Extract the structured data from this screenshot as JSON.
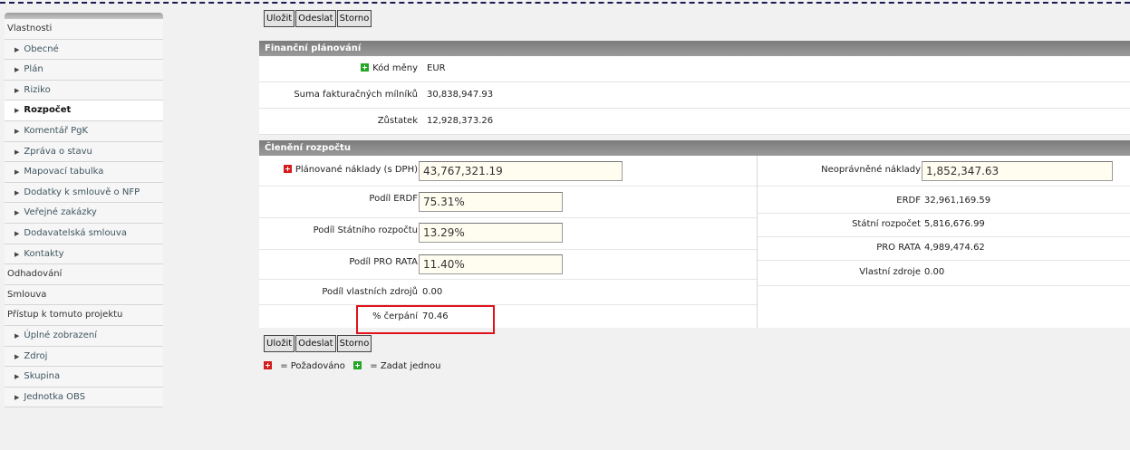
{
  "sidebar": {
    "items": [
      {
        "label": "Vlastnosti",
        "level": "top"
      },
      {
        "label": "Obecné",
        "level": "sub"
      },
      {
        "label": "Plán",
        "level": "sub"
      },
      {
        "label": "Riziko",
        "level": "sub"
      },
      {
        "label": "Rozpočet",
        "level": "sub",
        "active": true
      },
      {
        "label": "Komentář PgK",
        "level": "sub"
      },
      {
        "label": "Zpráva o stavu",
        "level": "sub"
      },
      {
        "label": "Mapovací tabulka",
        "level": "sub"
      },
      {
        "label": "Dodatky k smlouvě o NFP",
        "level": "sub"
      },
      {
        "label": "Veřejné zakázky",
        "level": "sub"
      },
      {
        "label": "Dodavatelská smlouva",
        "level": "sub"
      },
      {
        "label": "Kontakty",
        "level": "sub"
      },
      {
        "label": "Odhadování",
        "level": "top"
      },
      {
        "label": "Smlouva",
        "level": "top"
      },
      {
        "label": "Přístup k tomuto projektu",
        "level": "top"
      },
      {
        "label": "Úplné zobrazení",
        "level": "sub"
      },
      {
        "label": "Zdroj",
        "level": "sub"
      },
      {
        "label": "Skupina",
        "level": "sub"
      },
      {
        "label": "Jednotka OBS",
        "level": "sub"
      }
    ]
  },
  "buttons": {
    "save": "Uložit",
    "send": "Odeslat",
    "cancel": "Storno"
  },
  "financni": {
    "title": "Finanční plánování",
    "kod_label": "Kód měny",
    "kod_value": "EUR",
    "suma_label": "Suma fakturačných mílníků",
    "suma_value": "30,838,947.93",
    "zustatek_label": "Zůstatek",
    "zustatek_value": "12,928,373.26"
  },
  "cleneni": {
    "title": "Členění rozpočtu",
    "planovane_label": "Plánované náklady (s DPH)",
    "planovane_value": "43,767,321.19",
    "erdf_podil_label": "Podíl ERDF",
    "erdf_podil_value": "75.31%",
    "statni_podil_label": "Podíl Státního rozpočtu",
    "statni_podil_value": "13.29%",
    "prorata_podil_label": "Podíl PRO RATA",
    "prorata_podil_value": "11.40%",
    "vlastni_podil_label": "Podíl vlastních zdrojů",
    "vlastni_podil_value": "0.00",
    "cerpani_label": "% čerpání",
    "cerpani_value": "70.46",
    "neopravnene_label": "Neoprávněné náklady",
    "neopravnene_value": "1,852,347.63",
    "erdf_label": "ERDF",
    "erdf_value": "32,961,169.59",
    "statni_label": "Státní rozpočet",
    "statni_value": "5,816,676.99",
    "prorata_label": "PRO RATA",
    "prorata_value": "4,989,474.62",
    "vlastni_label": "Vlastní zdroje",
    "vlastni_value": "0.00"
  },
  "legend": {
    "required": "= Požadováno",
    "enter_once": "= Zadat jednou"
  },
  "colors": {
    "required": "#d51c1c",
    "enter_once": "#23a623",
    "highlight": "#e0121b"
  }
}
